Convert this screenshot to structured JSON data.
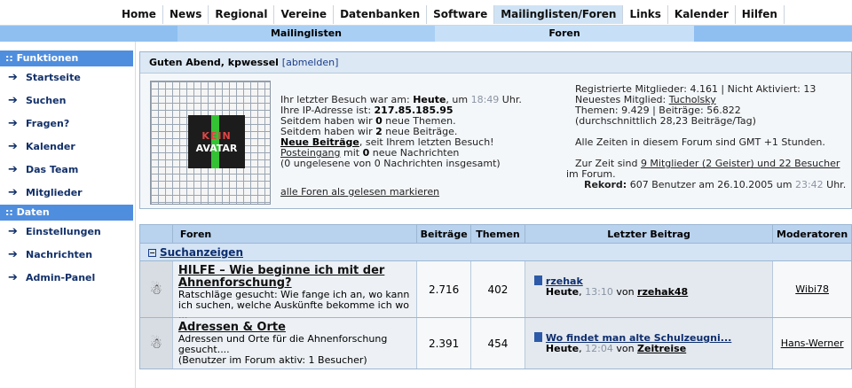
{
  "topnav": {
    "tabs": [
      "Home",
      "News",
      "Regional",
      "Vereine",
      "Datenbanken",
      "Software",
      "Mailinglisten/Foren",
      "Links",
      "Kalender",
      "Hilfen"
    ],
    "active": "Mailinglisten/Foren"
  },
  "subnav": {
    "a": "Mailinglisten",
    "b": "Foren"
  },
  "sidebar": {
    "head1": ":: Funktionen",
    "items1": [
      "Startseite",
      "Suchen",
      "Fragen?",
      "Kalender",
      "Das Team",
      "Mitglieder"
    ],
    "head2": ":: Daten",
    "items2": [
      "Einstellungen",
      "Nachrichten",
      "Admin-Panel"
    ]
  },
  "welcome": {
    "greeting": "Guten Abend, kpwessel",
    "logout": "[abmelden]",
    "avatar_line1": "KEIN",
    "avatar_line2": "AVATAR",
    "last_visit_pre": "Ihr letzter Besuch war am: ",
    "last_visit_day": "Heute",
    "last_visit_mid": ", um ",
    "last_visit_time": "18:49",
    "last_visit_post": " Uhr.",
    "ip_pre": "Ihre IP-Adresse ist: ",
    "ip": "217.85.185.95",
    "new_topics_pre": "Seitdem haben wir ",
    "new_topics": "0",
    "new_topics_post": " neue Themen.",
    "new_posts_pre": "Seitdem haben wir ",
    "new_posts": "2",
    "new_posts_post": " neue Beiträge.",
    "new_link": "Neue Beiträge",
    "new_link_post": ", seit Ihrem letzten Besuch!",
    "inbox_link": "Posteingang",
    "inbox_mid": " mit ",
    "inbox_count": "0",
    "inbox_post": " neue Nachrichten",
    "unread": "(0 ungelesene von 0 Nachrichten insgesamt)",
    "mark_all": "alle Foren als gelesen markieren",
    "reg_members": "Registrierte Mitglieder: 4.161 | Nicht Aktiviert: 13",
    "newest_pre": "Neuestes Mitglied: ",
    "newest": "Tucholsky",
    "topics_posts": "Themen: 9.429 | Beiträge: 56.822",
    "avg": "(durchschnittlich 28,23 Beiträge/Tag)",
    "timezone": "Alle Zeiten in diesem Forum sind GMT +1 Stunden.",
    "online_pre": "Zur Zeit sind ",
    "online_link": "9 Mitglieder (2 Geister) und 22 Besucher",
    "online_post": "im Forum.",
    "record_pre": "Rekord:",
    "record_mid": " 607 Benutzer am 26.10.2005 um ",
    "record_time": "23:42",
    "record_post": " Uhr."
  },
  "table": {
    "headers": {
      "forum": "Foren",
      "posts": "Beiträge",
      "topics": "Themen",
      "last": "Letzter Beitrag",
      "mods": "Moderatoren"
    },
    "category": "Suchanzeigen",
    "rows": [
      {
        "title": "HILFE – Wie beginne ich mit der Ahnenforschung?",
        "desc": "Ratschläge gesucht: Wie fange ich an, wo kann ich suchen, welche Auskünfte bekomme ich wo ...",
        "extra": "",
        "posts": "2.716",
        "topics": "402",
        "last_title": "rzehak",
        "last_day": "Heute",
        "last_time": "13:10",
        "last_by": "von",
        "last_user": "rzehak48",
        "mod": "Wibi78"
      },
      {
        "title": "Adressen & Orte",
        "desc": "Adressen und Orte für die Ahnenforschung gesucht....",
        "extra": "(Benutzer im Forum aktiv: 1 Besucher)",
        "posts": "2.391",
        "topics": "454",
        "last_title": "Wo findet man alte Schulzeugni...",
        "last_day": "Heute",
        "last_time": "12:04",
        "last_by": "von",
        "last_user": "Zeitreise",
        "mod": "Hans-Werner"
      }
    ]
  },
  "icons": {
    "nav_arrow": "arrow-right-icon",
    "forum": "forum-folder-icon",
    "post": "post-document-icon"
  }
}
